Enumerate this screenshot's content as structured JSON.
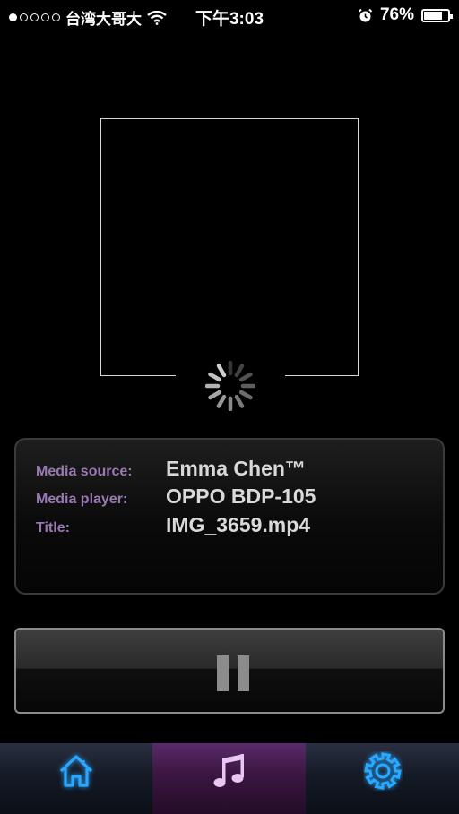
{
  "status_bar": {
    "carrier": "台湾大哥大",
    "time": "下午3:03",
    "battery_percent": "76%",
    "battery_level": 0.76,
    "signal_strength": 1,
    "signal_max": 5,
    "icons": [
      "signal-dots-icon",
      "wifi-icon",
      "alarm-icon",
      "battery-icon"
    ]
  },
  "artwork": {
    "loading": true,
    "icon": "loading-spinner-icon"
  },
  "info": {
    "media_source_label": "Media source:",
    "media_source_value": "Emma Chen™",
    "media_player_label": "Media player:",
    "media_player_value": "OPPO BDP-105",
    "title_label": "Title:",
    "title_value": "IMG_3659.mp4"
  },
  "controls": {
    "icon": "pause-icon"
  },
  "tab_bar": {
    "active": "music",
    "tabs": [
      {
        "id": "home",
        "icon": "home-icon"
      },
      {
        "id": "music",
        "icon": "music-note-icon"
      },
      {
        "id": "settings",
        "icon": "gear-icon"
      }
    ]
  },
  "colors": {
    "label": "#9a78b4",
    "value": "#d9d9d9",
    "tab_icon_glow": "#2aa8ff",
    "active_tab": "#3a1640"
  }
}
